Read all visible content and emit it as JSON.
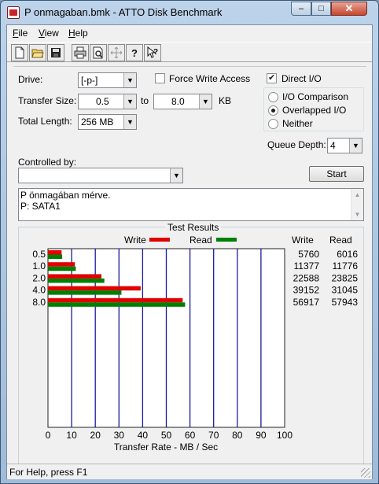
{
  "window": {
    "title": "P onmagaban.bmk - ATTO Disk Benchmark",
    "controls": {
      "minimize": "–",
      "maximize": "□",
      "close": "✕"
    }
  },
  "menu": {
    "file": "File",
    "view": "View",
    "help": "Help"
  },
  "toolbar": {
    "icons": [
      "new-icon",
      "open-icon",
      "save-icon",
      "print-icon",
      "print-preview-icon",
      "move-icon",
      "help-icon",
      "context-help-icon"
    ]
  },
  "form": {
    "drive_label": "Drive:",
    "drive_value": "[-p-]",
    "force_write_label": "Force Write Access",
    "force_write_checked": false,
    "direct_io_label": "Direct I/O",
    "direct_io_checked": true,
    "transfer_size_label": "Transfer Size:",
    "transfer_from": "0.5",
    "to_label": "to",
    "transfer_to": "8.0",
    "kb_label": "KB",
    "total_length_label": "Total Length:",
    "total_length_value": "256 MB",
    "io_options": [
      "I/O Comparison",
      "Overlapped I/O",
      "Neither"
    ],
    "io_selected": "Overlapped I/O",
    "queue_depth_label": "Queue Depth:",
    "queue_depth_value": "4",
    "controlled_by_label": "Controlled by:",
    "controlled_by_value": "",
    "start_label": "Start",
    "description_lines": [
      "P önmagában mérve.",
      "P: SATA1"
    ]
  },
  "results": {
    "title": "Test Results",
    "legend_write": "Write",
    "legend_read": "Read",
    "col_write": "Write",
    "col_read": "Read",
    "xlabel": "Transfer Rate - MB / Sec",
    "colors": {
      "write": "#e00000",
      "read": "#008000",
      "grid": "#1a1aa0"
    }
  },
  "chart_data": {
    "type": "bar",
    "orientation": "horizontal",
    "categories": [
      "0.5",
      "1.0",
      "2.0",
      "4.0",
      "8.0"
    ],
    "series": [
      {
        "name": "Write",
        "values": [
          5.76,
          11.377,
          22.588,
          39.152,
          56.917
        ]
      },
      {
        "name": "Read",
        "values": [
          6.016,
          11.776,
          23.825,
          31.045,
          57.943
        ]
      }
    ],
    "write_values": [
      "5760",
      "11377",
      "22588",
      "39152",
      "56917"
    ],
    "read_values": [
      "6016",
      "11776",
      "23825",
      "31045",
      "57943"
    ],
    "xlabel": "Transfer Rate - MB / Sec",
    "xticks": [
      "0",
      "10",
      "20",
      "30",
      "40",
      "50",
      "60",
      "70",
      "80",
      "90",
      "100"
    ],
    "xlim": [
      0,
      100
    ],
    "grid": true,
    "legend": "top"
  },
  "status": {
    "text": "For Help, press F1"
  }
}
